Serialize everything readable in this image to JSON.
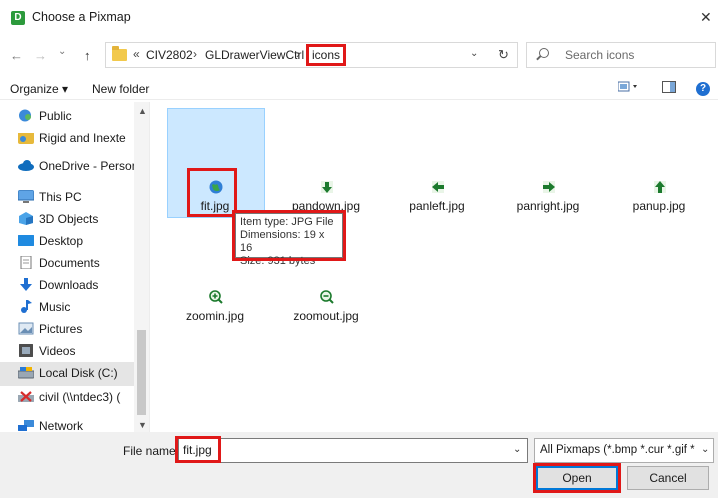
{
  "window": {
    "title": "Choose a Pixmap",
    "app_icon_letter": "D",
    "close_symbol": "✕"
  },
  "nav": {
    "back_symbol": "←",
    "forward_symbol": "→",
    "recent_symbol": "⌄",
    "up_symbol": "↑",
    "breadcrumb": {
      "overflow": "«",
      "items": [
        "CIV2802",
        "GLDrawerViewCtrl",
        "icons"
      ],
      "separator": "›"
    },
    "dropdown_symbol": "⌄",
    "refresh_symbol": "↻",
    "search_placeholder": "Search icons"
  },
  "toolbar": {
    "organize": "Organize ▾",
    "new_folder": "New folder",
    "help": "?"
  },
  "sidebar": {
    "items": [
      {
        "label": "Public",
        "icon": "public-folder-icon"
      },
      {
        "label": "Rigid and Inexte",
        "icon": "shared-folder-icon"
      },
      {
        "label": "OneDrive - Person",
        "icon": "onedrive-icon"
      },
      {
        "label": "This PC",
        "icon": "pc-icon"
      },
      {
        "label": "3D Objects",
        "icon": "3d-objects-icon"
      },
      {
        "label": "Desktop",
        "icon": "desktop-icon"
      },
      {
        "label": "Documents",
        "icon": "documents-icon"
      },
      {
        "label": "Downloads",
        "icon": "downloads-icon"
      },
      {
        "label": "Music",
        "icon": "music-icon"
      },
      {
        "label": "Pictures",
        "icon": "pictures-icon"
      },
      {
        "label": "Videos",
        "icon": "videos-icon"
      },
      {
        "label": "Local Disk (C:)",
        "icon": "disk-icon"
      },
      {
        "label": "civil (\\\\ntdec3) (",
        "icon": "network-drive-icon"
      },
      {
        "label": "Network",
        "icon": "network-icon"
      }
    ]
  },
  "files": [
    {
      "name": "fit.jpg",
      "icon": "globe-icon"
    },
    {
      "name": "pandown.jpg",
      "icon": "arrow-down-icon"
    },
    {
      "name": "panleft.jpg",
      "icon": "arrow-left-icon"
    },
    {
      "name": "panright.jpg",
      "icon": "arrow-right-icon"
    },
    {
      "name": "panup.jpg",
      "icon": "arrow-up-icon"
    },
    {
      "name": "zoomin.jpg",
      "icon": "zoom-in-icon"
    },
    {
      "name": "zoomout.jpg",
      "icon": "zoom-out-icon"
    }
  ],
  "tooltip": {
    "line1": "Item type: JPG File",
    "line2": "Dimensions: 19 x 16",
    "line3": "Size: 931 bytes"
  },
  "footer": {
    "file_name_label": "File name:",
    "file_name_value": "fit.jpg",
    "file_type": "All Pixmaps (*.bmp *.cur *.gif *",
    "open_label": "Open",
    "cancel_label": "Cancel"
  },
  "colors": {
    "accent": "#0078d7",
    "highlight_box": "#e01818",
    "selection": "#cce8ff"
  }
}
